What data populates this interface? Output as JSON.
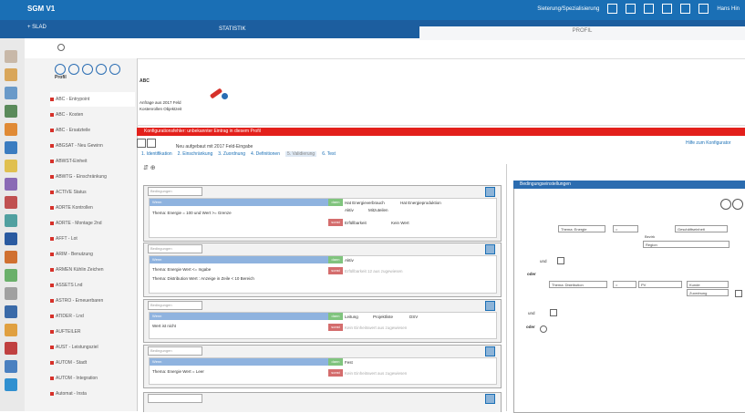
{
  "app": {
    "title": "SGM V1"
  },
  "topbar": {
    "search_label": "Sieterung/Spezialisierung",
    "user_label": "Hans Hin"
  },
  "tabs": {
    "left": "+ SLAD",
    "statistic": "STATISTIK",
    "active": "PROFIL"
  },
  "sidebar": {
    "heading": "Profil",
    "items": [
      "ABC - Entrypoint",
      "ABC - Kosten",
      "ABC - Ersatzteile",
      "ABGSAT - Neu Gewinn",
      "ABWST-Einheit",
      "ABWTG - Einschränkung",
      "ACTIVE Status",
      "ADRTE Kontrollen",
      "ADRTE - Montage 2nd",
      "AFFT - Lot",
      "ARIM - Benutzung",
      "ARMEN Kühlin Zeichen",
      "ASSETS Lnd",
      "ASTRO - Erneuerbaren",
      "ATIDER - Lnd",
      "AUFTEILER",
      "AUST - Leistungsziel",
      "AUTOM - Stadt",
      "AUTOM - Integration",
      "Automat - Insta"
    ]
  },
  "property": {
    "name": "ABC",
    "desc_line1": "Anfrage aus 2017 Feld",
    "desc_line2": "Kostenrollen Objektzeit"
  },
  "alert": {
    "text": "Konfigurationsfehler: unbekannter Eintrag in diesem Profil"
  },
  "actions": {
    "rebuild_label": "Neu aufgebaut mit 2017 Feld-Eingabe",
    "help_link": "Hilfe zum Konfigurator"
  },
  "steps": [
    "1. Identifikation",
    "2. Einschränkung",
    "3. Zuordnung",
    "4. Definitionen",
    "5. Validierung",
    "6. Test"
  ],
  "rules": [
    {
      "label": "Bedingungen",
      "header": "Wenn",
      "cond": "Thema: Energie = 100 und Wert >= Grenze",
      "and_results": [
        "Hat Energieverbrauch",
        "Hat Energieproduktion",
        "Aktiv",
        "Mitzuteilen"
      ],
      "or_results": [
        "Erfüllbarkeit",
        "Kein Wert"
      ]
    },
    {
      "label": "Bedingungen",
      "header": "Wenn",
      "cond": "Thema: Energie Wert <= Ingabe",
      "cond2": "Thema: Distribution Wert : Anzeige in Zeile < 10 Bereich",
      "and_results": [
        "Aktiv"
      ],
      "or_results": [
        "Erfüllbarkeit 12 aus zugewiesen"
      ]
    },
    {
      "label": "Bedingungen",
      "header": "Wenn",
      "cond": "Wert ist nicht",
      "and_results": [
        "Leitung",
        "Projektliste",
        "DSV"
      ],
      "or_results": [
        "Kein Einheitswert aus zugewiesen"
      ]
    },
    {
      "label": "Bedingungen",
      "header": "Wenn",
      "cond": "Thema: Energie Wert = Leer",
      "and_results": [
        "Fest"
      ],
      "or_results": [
        "Kein Einheitswert aus zugewiesen"
      ]
    }
  ],
  "editor": {
    "title": "Bedingungseinstellungen",
    "field1": "Thema: Energie",
    "op1": "=",
    "value1": "Geschäftseinheit",
    "sub1": "Bezirk",
    "sub1b": "Region",
    "and_label": "und",
    "field2": "Thema: Distribution",
    "op2": "=",
    "value2": "PV",
    "value2b": "Zuordnung",
    "value2c": "Kunde",
    "or_label": "oder",
    "and_label2": "und",
    "or_label2": "oder"
  }
}
